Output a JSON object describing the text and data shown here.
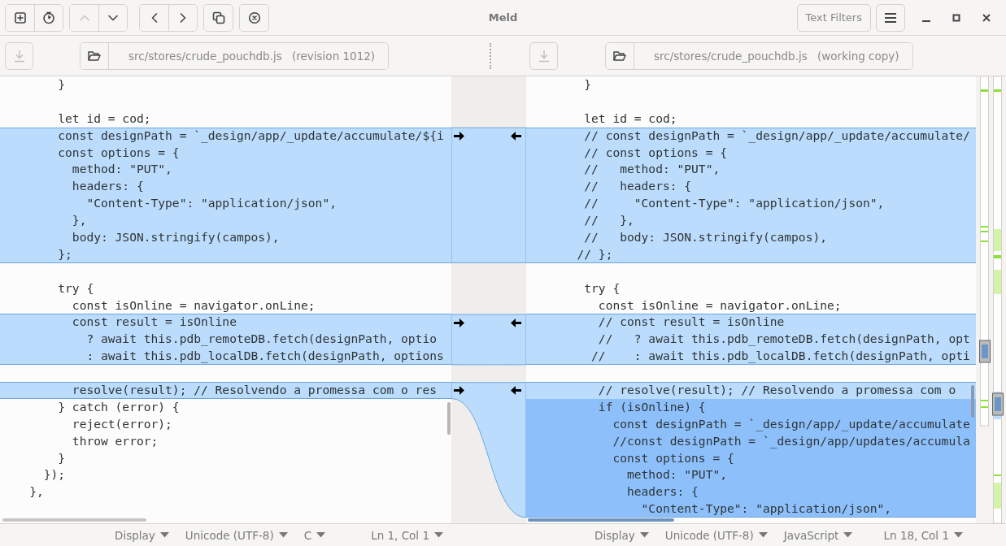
{
  "window": {
    "title": "Meld"
  },
  "toolbar": {
    "groups": [
      [
        {
          "kind": "new-tab",
          "disabled": false
        },
        {
          "kind": "history",
          "disabled": false
        }
      ],
      [
        {
          "kind": "up",
          "disabled": true
        },
        {
          "kind": "down",
          "disabled": false
        }
      ],
      [
        {
          "kind": "previous",
          "disabled": false
        },
        {
          "kind": "next",
          "disabled": false
        }
      ],
      [
        {
          "kind": "copy",
          "disabled": false
        }
      ],
      [
        {
          "kind": "stop",
          "disabled": false
        }
      ]
    ],
    "text_filters": "Text Filters"
  },
  "panes": [
    {
      "save_disabled": true,
      "file": {
        "path": "src/stores/crude_pouchdb.js",
        "note": "(revision 1012)"
      },
      "lines": [
        {
          "text": "        }",
          "kind": "plain"
        },
        {
          "kind": "plain"
        },
        {
          "text": "        let id = cod;",
          "kind": "plain"
        },
        {
          "text": "        const designPath = `_design/app/_update/accumulate/${i",
          "kind": "changed"
        },
        {
          "text": "        const options = {",
          "kind": "changed"
        },
        {
          "text": "          method: \"PUT\",",
          "kind": "changed"
        },
        {
          "text": "          headers: {",
          "kind": "changed"
        },
        {
          "text": "            \"Content-Type\": \"application/json\",",
          "kind": "changed"
        },
        {
          "text": "          },",
          "kind": "changed"
        },
        {
          "text": "          body: JSON.stringify(campos),",
          "kind": "changed"
        },
        {
          "text": "        };",
          "kind": "changed"
        },
        {
          "kind": "plain"
        },
        {
          "text": "        try {",
          "kind": "plain"
        },
        {
          "text": "          const isOnline = navigator.onLine;",
          "kind": "plain"
        },
        {
          "text": "          const result = isOnline",
          "kind": "changed"
        },
        {
          "text": "            ? await this.pdb_remoteDB.fetch(designPath, optio",
          "kind": "changed"
        },
        {
          "text": "            : await this.pdb_localDB.fetch(designPath, options",
          "kind": "changed"
        },
        {
          "kind": "plain"
        },
        {
          "text": "          resolve(result); // Resolvendo a promessa com o res",
          "kind": "changed"
        },
        {
          "text": "        } catch (error) {",
          "kind": "plain"
        },
        {
          "text": "          reject(error);",
          "kind": "plain"
        },
        {
          "text": "          throw error;",
          "kind": "plain"
        },
        {
          "text": "        }",
          "kind": "plain"
        },
        {
          "text": "      });",
          "kind": "plain"
        },
        {
          "text": "    },",
          "kind": "plain"
        }
      ],
      "status": {
        "display": "Display",
        "encoding": "Unicode (UTF-8)",
        "language": "C",
        "position": "Ln 1, Col 1"
      }
    },
    {
      "save_disabled": true,
      "file": {
        "path": "src/stores/crude_pouchdb.js",
        "note": "(working copy)"
      },
      "lines": [
        {
          "text": "        }",
          "kind": "plain"
        },
        {
          "kind": "plain"
        },
        {
          "text": "        let id = cod;",
          "kind": "plain"
        },
        {
          "text": "        // const designPath = `_design/app/_update/accumulate/",
          "kind": "changed"
        },
        {
          "text": "        // const options = {",
          "kind": "changed"
        },
        {
          "text": "        //   method: \"PUT\",",
          "kind": "changed"
        },
        {
          "text": "        //   headers: {",
          "kind": "changed"
        },
        {
          "text": "        //     \"Content-Type\": \"application/json\",",
          "kind": "changed"
        },
        {
          "text": "        //   },",
          "kind": "changed"
        },
        {
          "text": "        //   body: JSON.stringify(campos),",
          "kind": "changed"
        },
        {
          "text": "       // };",
          "kind": "changed"
        },
        {
          "kind": "plain"
        },
        {
          "text": "        try {",
          "kind": "plain"
        },
        {
          "text": "          const isOnline = navigator.onLine;",
          "kind": "plain"
        },
        {
          "text": "          // const result = isOnline",
          "kind": "changed"
        },
        {
          "text": "          //   ? await this.pdb_remoteDB.fetch(designPath, opt",
          "kind": "changed"
        },
        {
          "text": "         //    : await this.pdb_localDB.fetch(designPath, opti",
          "kind": "changed"
        },
        {
          "kind": "plain"
        },
        {
          "text": "          // resolve(result); // Resolvendo a promessa com o",
          "kind": "changed"
        },
        {
          "text": "          if (isOnline) {",
          "kind": "inserted"
        },
        {
          "text": "            const designPath = `_design/app/_update/accumulate",
          "kind": "inserted"
        },
        {
          "text": "            //const designPath = `_design/app/updates/accumula",
          "kind": "inserted"
        },
        {
          "text": "            const options = {",
          "kind": "inserted"
        },
        {
          "text": "              method: \"PUT\",",
          "kind": "inserted"
        },
        {
          "text": "              headers: {",
          "kind": "inserted"
        },
        {
          "text": "                \"Content-Type\": \"application/json\",",
          "kind": "inserted"
        }
      ],
      "status": {
        "display": "Display",
        "encoding": "Unicode (UTF-8)",
        "language": "JavaScript",
        "position": "Ln 18, Col 1"
      }
    }
  ]
}
